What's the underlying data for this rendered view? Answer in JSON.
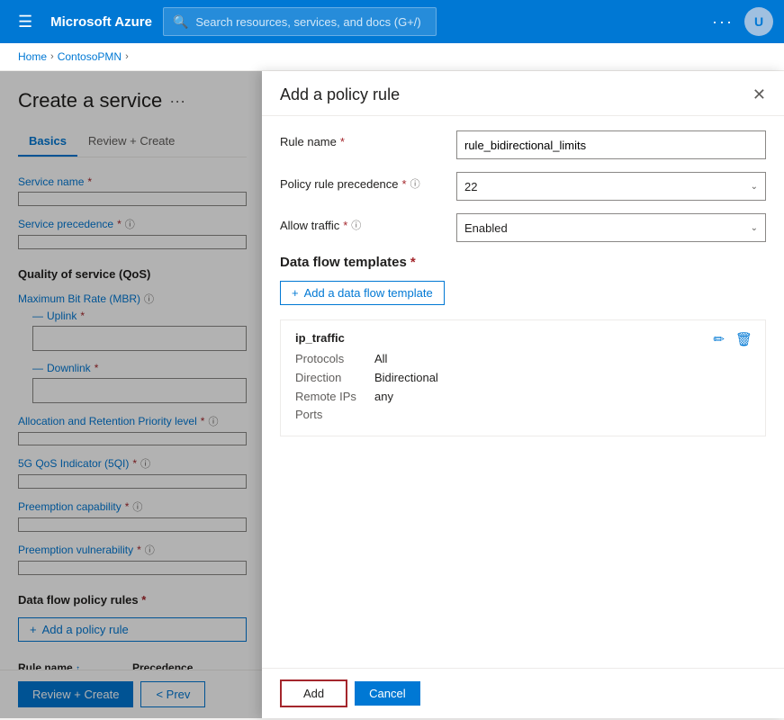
{
  "nav": {
    "hamburger": "☰",
    "title": "Microsoft Azure",
    "search_placeholder": "Search resources, services, and docs (G+/)",
    "dots": "···",
    "avatar_initials": "U"
  },
  "breadcrumb": {
    "items": [
      "Home",
      "ContosoPMN"
    ]
  },
  "left_panel": {
    "page_title": "Create a service",
    "page_title_dots": "···",
    "tabs": [
      {
        "label": "Basics",
        "active": true
      },
      {
        "label": "Review + Create",
        "active": false
      }
    ],
    "fields": {
      "service_name_label": "Service name",
      "service_name_required": "*",
      "service_precedence_label": "Service precedence",
      "service_precedence_required": "*"
    },
    "qos_section": {
      "title": "Quality of service (QoS)",
      "mbr_label": "Maximum Bit Rate (MBR)",
      "uplink_label": "Uplink",
      "uplink_required": "*",
      "downlink_label": "Downlink",
      "downlink_required": "*",
      "arp_label": "Allocation and Retention Priority level",
      "arp_required": "*",
      "qos_5g_label": "5G QoS Indicator (5QI)",
      "qos_5g_required": "*",
      "preemption_cap_label": "Preemption capability",
      "preemption_cap_required": "*",
      "preemption_vuln_label": "Preemption vulnerability",
      "preemption_vuln_required": "*"
    },
    "policy_rules": {
      "title": "Data flow policy rules",
      "title_required": "*",
      "add_btn": "Add a policy rule",
      "table_headers": [
        {
          "label": "Rule name",
          "sort": "↑"
        },
        {
          "label": "Precedence"
        }
      ]
    },
    "bottom_bar": {
      "review_create_btn": "Review + Create",
      "prev_btn": "< Prev"
    }
  },
  "modal": {
    "title": "Add a policy rule",
    "close_icon": "✕",
    "fields": {
      "rule_name_label": "Rule name",
      "rule_name_required": "*",
      "rule_name_value": "rule_bidirectional_limits",
      "precedence_label": "Policy rule precedence",
      "precedence_required": "*",
      "precedence_value": "22",
      "allow_traffic_label": "Allow traffic",
      "allow_traffic_required": "*",
      "allow_traffic_value": "Enabled"
    },
    "data_flow": {
      "title": "Data flow templates",
      "title_required": "*",
      "add_btn": "Add a data flow template",
      "template": {
        "name": "ip_traffic",
        "protocols_label": "Protocols",
        "protocols_value": "All",
        "direction_label": "Direction",
        "direction_value": "Bidirectional",
        "remote_ips_label": "Remote IPs",
        "remote_ips_value": "any",
        "ports_label": "Ports",
        "ports_value": ""
      }
    },
    "footer": {
      "add_btn": "Add",
      "cancel_btn": "Cancel"
    }
  },
  "icons": {
    "search": "🔍",
    "hamburger": "☰",
    "edit": "✏",
    "delete": "🗑",
    "plus": "+",
    "info": "ⓘ",
    "chevron_down": "⌄",
    "sort_up": "↑"
  },
  "colors": {
    "azure_blue": "#0078d4",
    "red_required": "#a4262c",
    "text_dark": "#201f1e",
    "text_medium": "#605e5c",
    "border": "#edebe9"
  }
}
